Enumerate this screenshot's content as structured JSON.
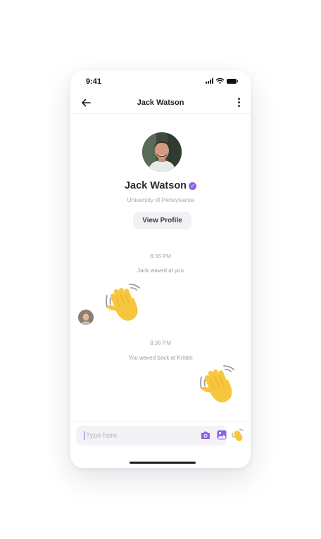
{
  "status_bar": {
    "time": "9:41"
  },
  "header": {
    "title": "Jack Watson"
  },
  "profile": {
    "name": "Jack Watson",
    "school": "University of Pensylvania",
    "view_profile_label": "View Profile"
  },
  "messages": [
    {
      "time": "8:36 PM",
      "text": "Jack waved at you",
      "sender": "Jack Watson"
    },
    {
      "time": "8:36 PM",
      "text": "You waved back at Kristin",
      "sender": "You"
    }
  ],
  "composer": {
    "placeholder": "Type here"
  },
  "colors": {
    "accent": "#8d63e6",
    "wave_yellow": "#f8c63c",
    "text_dark": "#2b2b2b",
    "text_muted": "#a5a5ad"
  },
  "icons": [
    "back-arrow-icon",
    "more-vertical-icon",
    "verified-icon",
    "camera-icon",
    "gallery-icon",
    "waving-hand-icon"
  ]
}
